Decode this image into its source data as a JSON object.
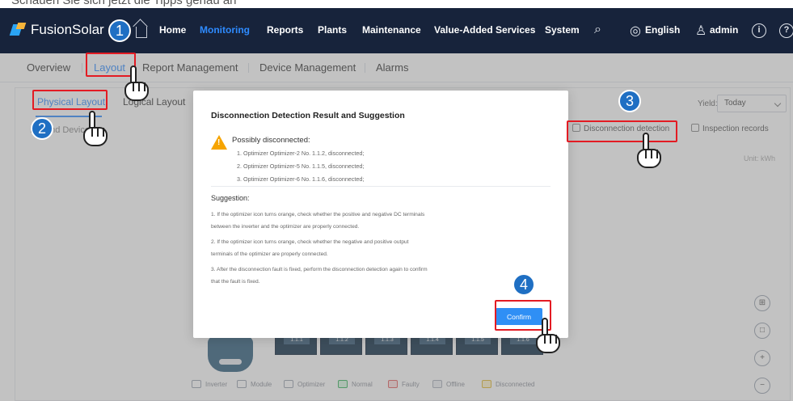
{
  "caption": {
    "text": "Schauen Sie sich jetzt die Tipps genau an"
  },
  "app": {
    "name": "FusionSolar"
  },
  "topnav": {
    "items": [
      "Home",
      "Monitoring",
      "Reports",
      "Plants",
      "Maintenance",
      "Value-Added Services",
      "System"
    ],
    "language": "English",
    "user": "admin"
  },
  "subnav": {
    "items": [
      "Overview",
      "Layout",
      "Report Management",
      "Device Management",
      "Alarms"
    ]
  },
  "layout_tabs": {
    "items": [
      "Physical Layout",
      "Logical Layout"
    ]
  },
  "toolbar": {
    "expand": "Expand Devices",
    "yield_label": "Yield:",
    "yield_value": "Today",
    "disconnection_detection": "Disconnection detection",
    "inspection_records": "Inspection records",
    "unit": "Unit: kWh"
  },
  "modules": [
    "1.1.1",
    "1.1.2",
    "1.1.3",
    "1.1.4",
    "1.1.5",
    "1.1.6"
  ],
  "string_label": "1",
  "legend": [
    "Inverter",
    "Module",
    "Optimizer",
    "Normal",
    "Faulty",
    "Offline",
    "Disconnected"
  ],
  "dialog": {
    "title": "Disconnection Detection Result and Suggestion",
    "possible": "Possibly disconnected:",
    "details": [
      "1. Optimizer Optimizer-2 No. 1.1.2, disconnected;",
      "2. Optimizer Optimizer-5 No. 1.1.5, disconnected;",
      "3. Optimizer Optimizer-6 No. 1.1.6, disconnected;"
    ],
    "suggestion_title": "Suggestion:",
    "suggestions": [
      "1. If the optimizer icon turns orange, check whether the positive and negative DC terminals",
      "between the inverter and the optimizer are properly connected.",
      "2. If the optimizer icon turns orange, check whether the negative and positive output",
      "terminals of the optimizer are properly connected.",
      "3. After the disconnection fault is fixed, perform the disconnection detection again to confirm",
      "that the fault is fixed."
    ],
    "confirm": "Confirm"
  },
  "annotations": {
    "steps": [
      "1",
      "2",
      "3",
      "4"
    ]
  },
  "colors": {
    "nav_bg": "#17233b",
    "accent": "#2e8bff",
    "confirm": "#2f8ff5",
    "annotation_red": "#e31b23",
    "warning": "#f6a400"
  }
}
